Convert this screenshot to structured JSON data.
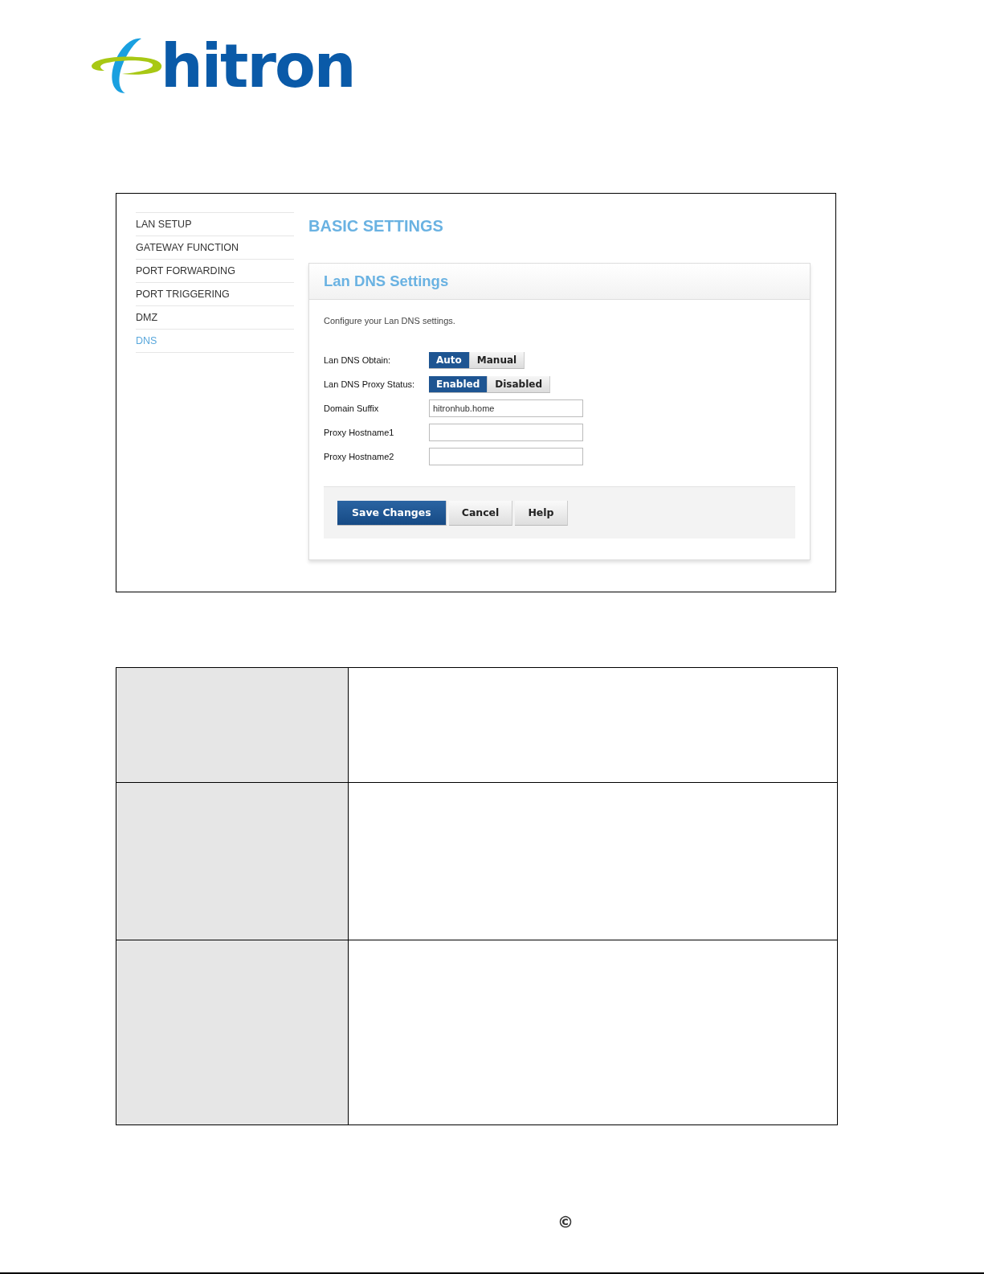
{
  "logo": {
    "text": "hitron"
  },
  "sidebar": {
    "items": [
      {
        "label": "LAN SETUP",
        "selected": false
      },
      {
        "label": "GATEWAY FUNCTION",
        "selected": false
      },
      {
        "label": "PORT FORWARDING",
        "selected": false
      },
      {
        "label": "PORT TRIGGERING",
        "selected": false
      },
      {
        "label": "DMZ",
        "selected": false
      },
      {
        "label": "DNS",
        "selected": true
      }
    ]
  },
  "page_title": "BASIC SETTINGS",
  "panel": {
    "title": "Lan DNS Settings",
    "description": "Configure your Lan DNS settings.",
    "fields": [
      {
        "kind": "toggle",
        "label": "Lan DNS Obtain:",
        "options": [
          {
            "label": "Auto",
            "selected": true
          },
          {
            "label": "Manual",
            "selected": false
          }
        ]
      },
      {
        "kind": "toggle",
        "label": "Lan DNS Proxy Status:",
        "options": [
          {
            "label": "Enabled",
            "selected": true
          },
          {
            "label": "Disabled",
            "selected": false
          }
        ]
      },
      {
        "kind": "text",
        "label": "Domain Suffix",
        "value": "hitronhub.home"
      },
      {
        "kind": "text",
        "label": "Proxy Hostname1"
      },
      {
        "kind": "text",
        "label": "Proxy Hostname2"
      }
    ],
    "buttons": [
      {
        "label": "Save Changes",
        "kind": "primary"
      },
      {
        "label": "Cancel",
        "kind": "default"
      },
      {
        "label": "Help",
        "kind": "default"
      }
    ]
  },
  "footer": {
    "copyright": "©"
  }
}
